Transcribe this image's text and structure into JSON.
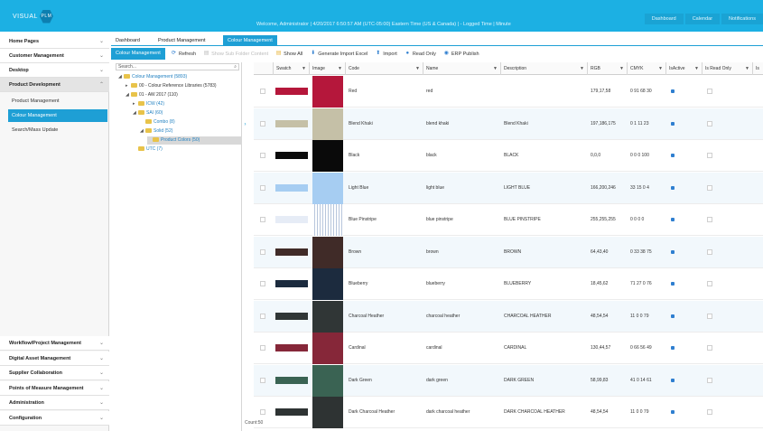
{
  "topbar": {
    "logo_text": "VISUAL",
    "logo_mark": "PLM",
    "welcome": "Welcome, Administrator  |  4/20/2017 6:50:57 AM (UTC-05:00) Eastern Time (US & Canada)  |  -  Logged Time  |  Minute",
    "right_items": [
      "Dashboard",
      "Calendar",
      "Notifications"
    ]
  },
  "leftnav": {
    "sections_top": [
      {
        "label": "Home Pages",
        "chev": "⌄"
      },
      {
        "label": "Customer Management",
        "chev": "⌄"
      },
      {
        "label": "Desktop",
        "chev": "⌄"
      },
      {
        "label": "Product Development",
        "chev": "⌃"
      }
    ],
    "subitems": [
      "Product Management",
      "Colour Management",
      "Search/Mass Update"
    ],
    "selected_subitem": "Colour Management",
    "sections_bottom": [
      {
        "label": "Workflow/Project Management",
        "chev": "⌄"
      },
      {
        "label": "Digital Asset Management",
        "chev": "⌄"
      },
      {
        "label": "Supplier Collaboration",
        "chev": "⌄"
      },
      {
        "label": "Points of Measure Management",
        "chev": "⌄"
      },
      {
        "label": "Administration",
        "chev": "⌄"
      },
      {
        "label": "Configuration",
        "chev": "⌄"
      }
    ]
  },
  "tabs": [
    "Dashboard",
    "Product Management",
    "Colour Management"
  ],
  "selected_tab": "Colour Management",
  "toolbar": {
    "title": "Colour Management",
    "buttons": [
      {
        "label": "Refresh",
        "icon": "refresh-icon",
        "glyph": "⟳",
        "color": "#2f7fd0",
        "disabled": false
      },
      {
        "label": "Show Sub Folder Content",
        "icon": "folder-icon",
        "glyph": "▤",
        "color": "#bbbbbb",
        "disabled": true
      },
      {
        "label": "Show All",
        "icon": "folder-icon",
        "glyph": "▤",
        "color": "#e8b53a",
        "disabled": false
      },
      {
        "label": "Generate Import Excel",
        "icon": "excel-icon",
        "glyph": "⬇",
        "color": "#2f7fd0",
        "disabled": false
      },
      {
        "label": "Import",
        "icon": "import-icon",
        "glyph": "⬆",
        "color": "#2f7fd0",
        "disabled": false
      },
      {
        "label": "Read Only",
        "icon": "info-icon",
        "glyph": "●",
        "color": "#2f7fd0",
        "disabled": false
      },
      {
        "label": "ERP Publish",
        "icon": "publish-icon",
        "glyph": "◉",
        "color": "#2f7fd0",
        "disabled": false
      }
    ]
  },
  "tree": {
    "search_placeholder": "Search...",
    "nodes": [
      {
        "label": "Colour Management (5893)",
        "exp": "◢",
        "level": 0,
        "blue": true,
        "selected": false
      },
      {
        "label": "00 - Colour Reference Libraries (5783)",
        "exp": "▸",
        "level": 1,
        "blue": false,
        "selected": false
      },
      {
        "label": "01 - AW 2017 (110)",
        "exp": "◢",
        "level": 1,
        "blue": false,
        "selected": false
      },
      {
        "label": "ICW (42)",
        "exp": "▸",
        "level": 2,
        "blue": true,
        "selected": false
      },
      {
        "label": "SAI (60)",
        "exp": "◢",
        "level": 2,
        "blue": true,
        "selected": false
      },
      {
        "label": "Combo (8)",
        "exp": "",
        "level": 3,
        "blue": true,
        "selected": false
      },
      {
        "label": "Solid (52)",
        "exp": "◢",
        "level": 3,
        "blue": true,
        "selected": false
      },
      {
        "label": "Product Colors (50)",
        "exp": "",
        "level": 4,
        "blue": true,
        "selected": true
      },
      {
        "label": "UTC (7)",
        "exp": "",
        "level": 2,
        "blue": true,
        "selected": false
      }
    ]
  },
  "grid": {
    "columns": [
      "",
      "Swatch",
      "Image",
      "Code",
      "Name",
      "Description",
      "RGB",
      "CMYK",
      "IsActive",
      "Is Read Only",
      "Is"
    ],
    "rows": [
      {
        "code": "Red",
        "name": "red",
        "desc": "",
        "rgb": "179,17,58",
        "cmyk": "0 91 68 30",
        "color": "#b5173b",
        "active": true
      },
      {
        "code": "Blend Khaki",
        "name": "blend khaki",
        "desc": "Blend Khaki",
        "rgb": "197,186,175",
        "cmyk": "0 1 11 23",
        "color": "#c5c0a7",
        "active": true
      },
      {
        "code": "Black",
        "name": "black",
        "desc": "BLACK",
        "rgb": "0,0,0",
        "cmyk": "0 0 0 100",
        "color": "#0a0a0a",
        "active": true
      },
      {
        "code": "Light Blue",
        "name": "light blue",
        "desc": "LIGHT BLUE",
        "rgb": "166,200,246",
        "cmyk": "33 15 0 4",
        "color": "#a6cdf2",
        "active": true
      },
      {
        "code": "Blue Pinstripe",
        "name": "blue pinstripe",
        "desc": "BLUE PINSTRIPE",
        "rgb": "255,255,255",
        "cmyk": "0 0 0 0",
        "color": "#e6ecf6",
        "active": true
      },
      {
        "code": "Brown",
        "name": "brown",
        "desc": "BROWN",
        "rgb": "64,43,40",
        "cmyk": "0 33 38 75",
        "color": "#402b28",
        "active": true
      },
      {
        "code": "Blueberry",
        "name": "blueberry",
        "desc": "BLUEBERRY",
        "rgb": "18,45,62",
        "cmyk": "71 27 0 76",
        "color": "#1c2b3e",
        "active": true
      },
      {
        "code": "Charcoal Heather",
        "name": "charcoal heather",
        "desc": "CHARCOAL HEATHER",
        "rgb": "48,54,54",
        "cmyk": "11 0 0 79",
        "color": "#303636",
        "active": true
      },
      {
        "code": "Cardinal",
        "name": "cardinal",
        "desc": "CARDINAL",
        "rgb": "130,44,57",
        "cmyk": "0 66 56 49",
        "color": "#862739",
        "active": true
      },
      {
        "code": "Dark Green",
        "name": "dark green",
        "desc": "DARK GREEN",
        "rgb": "58,99,83",
        "cmyk": "41 0 14 61",
        "color": "#3a6353",
        "active": true
      },
      {
        "code": "Dark Charcoal Heather",
        "name": "dark charcoal heather",
        "desc": "DARK CHARCOAL HEATHER",
        "rgb": "48,54,54",
        "cmyk": "11 0 0 79",
        "color": "#2e3333",
        "active": true
      }
    ],
    "count_label": "Count:50"
  }
}
